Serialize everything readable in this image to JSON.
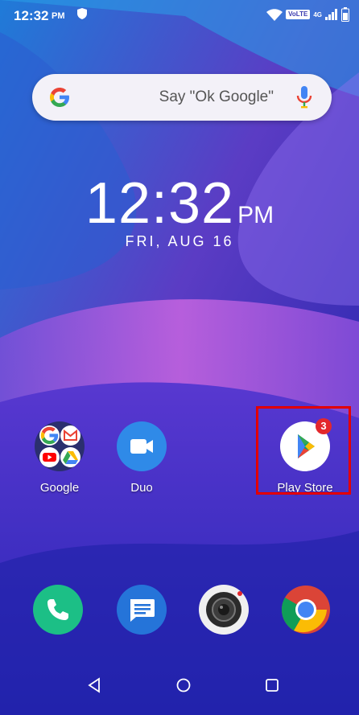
{
  "status_bar": {
    "time": "12:32",
    "ampm": "PM",
    "volte_label": "VoLTE",
    "network_label": "4G"
  },
  "search": {
    "hint": "Say \"Ok Google\""
  },
  "clock": {
    "time": "12:32",
    "ampm": "PM",
    "date": "FRI, AUG 16"
  },
  "apps": {
    "google": {
      "label": "Google"
    },
    "duo": {
      "label": "Duo"
    },
    "play_store": {
      "label": "Play Store",
      "badge": "3"
    }
  },
  "dock": {
    "items": [
      "phone-icon",
      "messages-icon",
      "camera-icon",
      "chrome-icon"
    ]
  },
  "colors": {
    "phone": "#1cbf86",
    "messages": "#2574d9",
    "duo": "#2f8ae8",
    "badge": "#e3272c",
    "highlight": "#e30000"
  }
}
